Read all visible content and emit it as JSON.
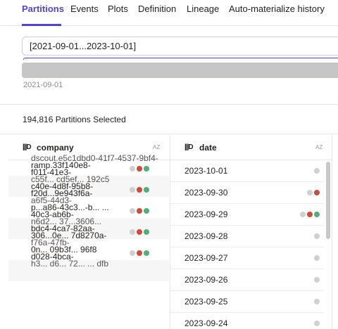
{
  "tabs": [
    {
      "label": "Partitions",
      "active": true
    },
    {
      "label": "Events",
      "active": false
    },
    {
      "label": "Plots",
      "active": false
    },
    {
      "label": "Definition",
      "active": false
    },
    {
      "label": "Lineage",
      "active": false
    },
    {
      "label": "Auto-materialize history",
      "active": false
    }
  ],
  "range": {
    "value": "[2021-09-01...2023-10-01]",
    "start_label": "2021-09-01"
  },
  "selected": {
    "label": "194,816 Partitions Selected"
  },
  "company_column": {
    "title": "company",
    "icon": "partition-icon",
    "sort_icon": "sort-az-icon",
    "sort_label": "AZ",
    "rows": [
      {
        "line1": "dscout.e5c1dbd0-41f7-4537-9bf4-",
        "line2": "ramp.33f140e8-",
        "line3": "f011-41e3-",
        "dots": [
          "gray",
          "red",
          "green"
        ]
      },
      {
        "line1": "c55f... cd5ef... 192c5",
        "line2": "c40e-4d8f-95b8-",
        "line3": "f20d...9e943f6a-",
        "dots": [
          "gray",
          "red",
          "green"
        ]
      },
      {
        "line1": "a6f5-44d3-",
        "line2": "p...a86-43c3...-b... ...",
        "line3": "40c3-ab6b-",
        "dots": [
          "gray",
          "red",
          "green"
        ]
      },
      {
        "line1": "n6d2... 37...3606...",
        "line2": "bdc4-4ca7-82aa-",
        "line3": "306...0e... 7d8270a-",
        "dots": [
          "gray",
          "red",
          "green"
        ]
      },
      {
        "line1": "f76a-47fb-",
        "line2": "0n... 09b3f... 96f8",
        "line3": "d028-4bca-",
        "dots": [
          "gray",
          "red",
          "green"
        ]
      },
      {
        "line1": "h3... d6... 72... ... dfb",
        "line2": "",
        "line3": "",
        "dots": []
      }
    ]
  },
  "date_column": {
    "title": "date",
    "icon": "partition-icon",
    "sort_icon": "sort-az-icon",
    "sort_label": "AZ",
    "rows": [
      {
        "label": "2023-10-01",
        "dots": [
          "gray"
        ]
      },
      {
        "label": "2023-09-30",
        "dots": [
          "gray",
          "red"
        ]
      },
      {
        "label": "2023-09-29",
        "dots": [
          "gray",
          "red",
          "green"
        ]
      },
      {
        "label": "2023-09-28",
        "dots": [
          "gray"
        ]
      },
      {
        "label": "2023-09-27",
        "dots": [
          "gray"
        ]
      },
      {
        "label": "2023-09-26",
        "dots": [
          "gray"
        ]
      },
      {
        "label": "2023-09-25",
        "dots": [
          "gray"
        ]
      },
      {
        "label": "2023-09-24",
        "dots": [
          "gray"
        ]
      }
    ]
  },
  "colors": {
    "accent": "#4f43dd",
    "status_missing": "#d0d0d0",
    "status_failed": "#cc4b3a",
    "status_success": "#4fae7a"
  }
}
